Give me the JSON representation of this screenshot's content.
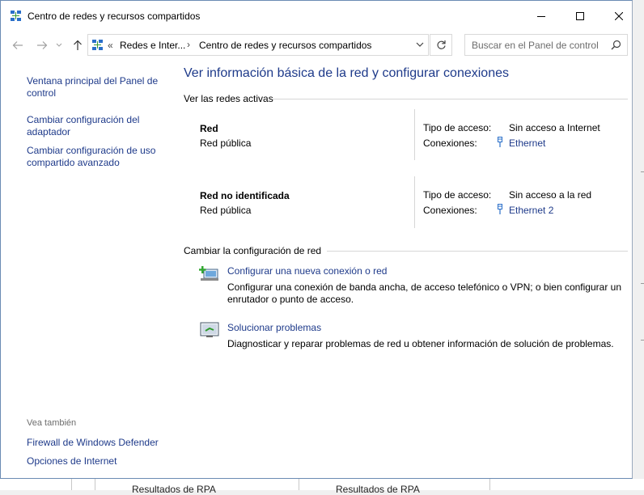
{
  "window": {
    "title": "Centro de redes y recursos compartidos"
  },
  "address": {
    "overflow": "«",
    "crumb1": "Redes e Inter...",
    "separator": "›",
    "crumb2": "Centro de redes y recursos compartidos"
  },
  "search": {
    "placeholder": "Buscar en el Panel de control"
  },
  "sidebar": {
    "links": [
      "Ventana principal del Panel de control",
      "Cambiar configuración del adaptador",
      "Cambiar configuración de uso compartido avanzado"
    ],
    "see_also": {
      "heading": "Vea también",
      "links": [
        "Firewall de Windows Defender",
        "Opciones de Internet"
      ]
    }
  },
  "main": {
    "title": "Ver información básica de la red y configurar conexiones",
    "active_networks_label": "Ver las redes activas",
    "access_type_label": "Tipo de acceso:",
    "connections_label": "Conexiones:",
    "networks": [
      {
        "name": "Red",
        "type": "Red pública",
        "access": "Sin acceso a Internet",
        "connection": "Ethernet"
      },
      {
        "name": "Red no identificada",
        "type": "Red pública",
        "access": "Sin acceso a la red",
        "connection": "Ethernet 2"
      }
    ],
    "change_settings_label": "Cambiar la configuración de red",
    "tasks": [
      {
        "link": "Configurar una nueva conexión o red",
        "description": "Configurar una conexión de banda ancha, de acceso telefónico o VPN; o bien configurar un enrutador o punto de acceso."
      },
      {
        "link": "Solucionar problemas",
        "description": "Diagnosticar y reparar problemas de red u obtener información de solución de problemas."
      }
    ]
  },
  "background": {
    "cells": [
      "Resultados de RPA",
      "Resultados de RPA"
    ]
  },
  "colors": {
    "link": "#1e3a8a",
    "border": "#6b8bb3",
    "rule": "#d6d6d6"
  }
}
